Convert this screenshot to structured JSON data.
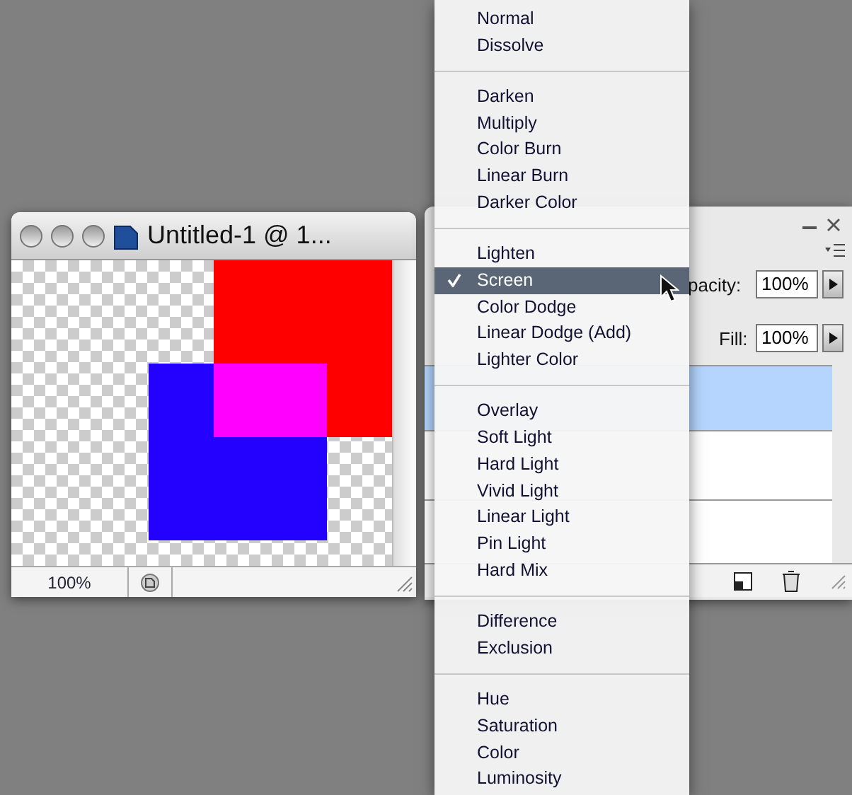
{
  "document_window": {
    "title": "Untitled-1 @ 1...",
    "zoom": "100%"
  },
  "layers_panel": {
    "opacity_label": "pacity:",
    "opacity": "100%",
    "fill_label": "Fill:",
    "fill": "100%"
  },
  "blend_menu": {
    "groups": [
      [
        {
          "label": "Normal",
          "selected": false
        },
        {
          "label": "Dissolve",
          "selected": false
        }
      ],
      [
        {
          "label": "Darken",
          "selected": false
        },
        {
          "label": "Multiply",
          "selected": false
        },
        {
          "label": "Color Burn",
          "selected": false
        },
        {
          "label": "Linear Burn",
          "selected": false
        },
        {
          "label": "Darker Color",
          "selected": false
        }
      ],
      [
        {
          "label": "Lighten",
          "selected": false
        },
        {
          "label": "Screen",
          "selected": true
        },
        {
          "label": "Color Dodge",
          "selected": false
        },
        {
          "label": "Linear Dodge (Add)",
          "selected": false
        },
        {
          "label": "Lighter Color",
          "selected": false
        }
      ],
      [
        {
          "label": "Overlay",
          "selected": false
        },
        {
          "label": "Soft Light",
          "selected": false
        },
        {
          "label": "Hard Light",
          "selected": false
        },
        {
          "label": "Vivid Light",
          "selected": false
        },
        {
          "label": "Linear Light",
          "selected": false
        },
        {
          "label": "Pin Light",
          "selected": false
        },
        {
          "label": "Hard Mix",
          "selected": false
        }
      ],
      [
        {
          "label": "Difference",
          "selected": false
        },
        {
          "label": "Exclusion",
          "selected": false
        }
      ],
      [
        {
          "label": "Hue",
          "selected": false
        },
        {
          "label": "Saturation",
          "selected": false
        },
        {
          "label": "Color",
          "selected": false
        },
        {
          "label": "Luminosity",
          "selected": false
        }
      ]
    ]
  }
}
